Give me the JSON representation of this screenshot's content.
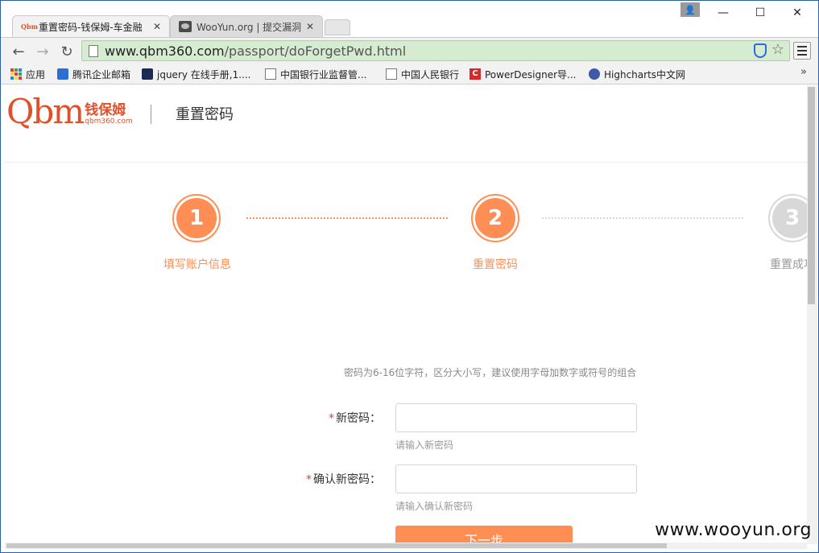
{
  "tabs": [
    {
      "title": "重置密码-钱保姆-车金融",
      "favicon": "Qbm"
    },
    {
      "title": "WooYun.org | 提交漏洞"
    }
  ],
  "toolbar": {
    "url_host": "www.qbm360.com",
    "url_path": "/passport/doForgetPwd.html"
  },
  "bookmarks": [
    {
      "label": "应用",
      "icon": "apps-grid-icon"
    },
    {
      "label": "腾讯企业邮箱",
      "icon": "mail-icon"
    },
    {
      "label": "jquery 在线手册,1....",
      "icon": "jquery-icon"
    },
    {
      "label": "中国银行业监督管...",
      "icon": "page-icon"
    },
    {
      "label": "中国人民银行",
      "icon": "page-icon"
    },
    {
      "label": "PowerDesigner导...",
      "icon": "powerdesigner-icon",
      "badge": "C"
    },
    {
      "label": "Highcharts中文网",
      "icon": "highcharts-icon"
    }
  ],
  "bookmarks_more": "»",
  "site": {
    "logo_mark": "Qbm",
    "logo_cn": "钱保姆",
    "logo_en": "qbm360.com",
    "page_title": "重置密码"
  },
  "steps": [
    {
      "number": "1",
      "label": "填写账户信息",
      "state": "done"
    },
    {
      "number": "2",
      "label": "重置密码",
      "state": "active"
    },
    {
      "number": "3",
      "label": "重置成功",
      "state": "pending"
    }
  ],
  "form": {
    "hint": "密码为6-16位字符，区分大小写，建议使用字母加数字或符号的组合",
    "required_mark": "*",
    "new_password_label": "新密码：",
    "new_password_tip": "请输入新密码",
    "confirm_password_label": "确认新密码：",
    "confirm_password_tip": "请输入确认新密码",
    "submit_label": "下一步"
  },
  "watermark": "www.wooyun.org",
  "colors": {
    "accent": "#ff8e54",
    "brand": "#e2502a",
    "pending": "#d8d8d8"
  }
}
